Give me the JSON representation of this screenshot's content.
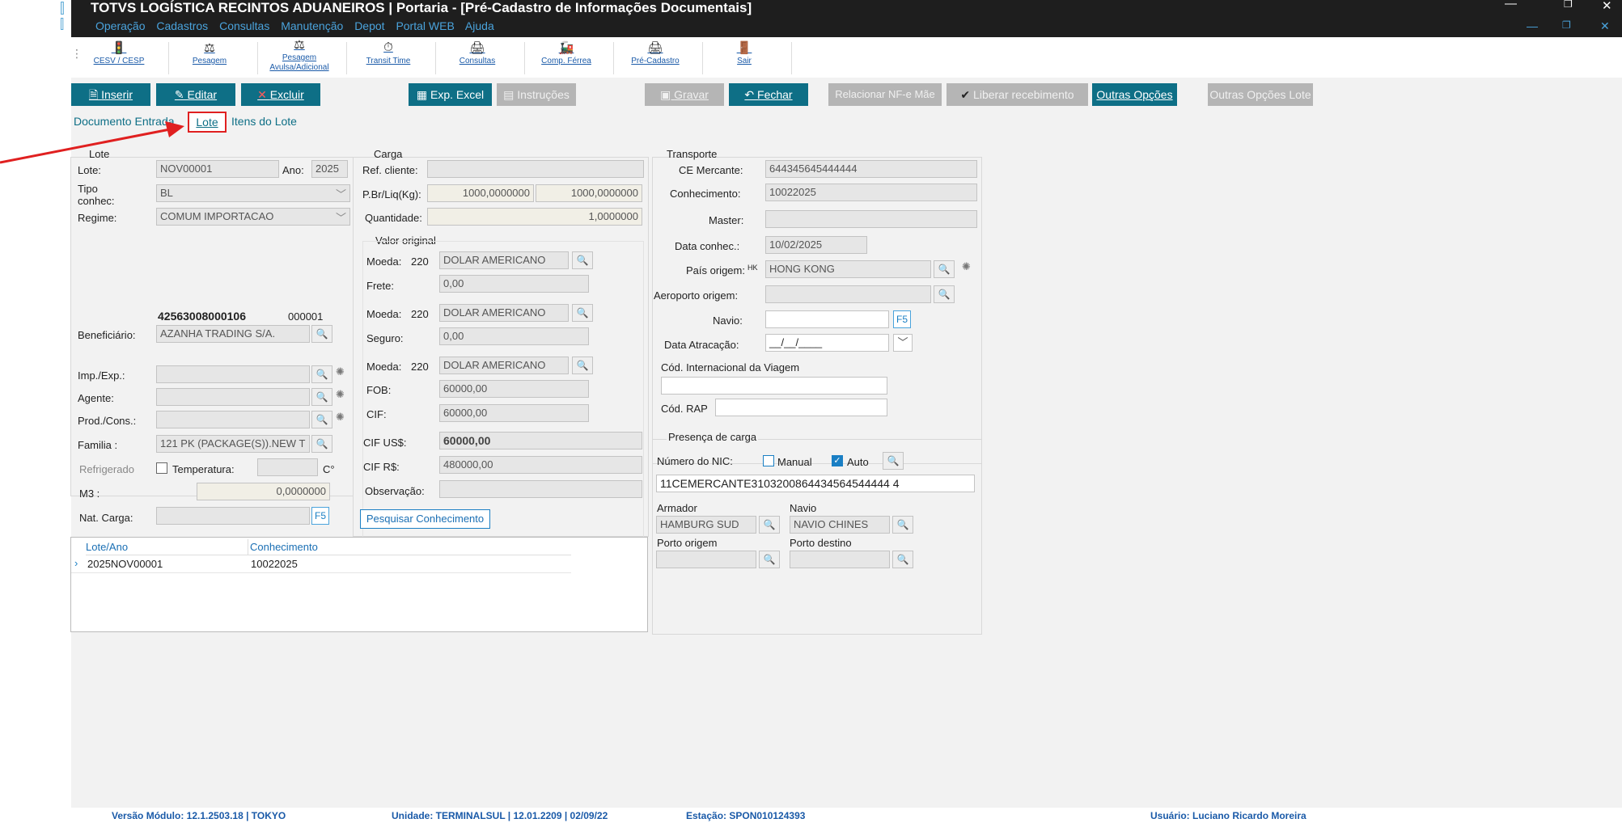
{
  "window": {
    "title": "TOTVS LOGÍSTICA RECINTOS ADUANEIROS | Portaria - [Pré-Cadastro de Informações Documentais]",
    "menu": [
      "Operação",
      "Cadastros",
      "Consultas",
      "Manutenção",
      "Depot",
      "Portal WEB",
      "Ajuda"
    ],
    "controls": {
      "minimize": "—",
      "restore": "❐",
      "close": "✕"
    }
  },
  "toolbar": [
    {
      "label": "CESV / CESP",
      "icon": "traffic-light-icon"
    },
    {
      "label": "Pesagem",
      "icon": "scale-icon"
    },
    {
      "label": "Pesagem Avulsa/Adicional",
      "icon": "scale-extra-icon"
    },
    {
      "label": "Transit Time",
      "icon": "clock-icon"
    },
    {
      "label": "Consultas",
      "icon": "printer-icon"
    },
    {
      "label": "Comp. Férrea",
      "icon": "train-icon"
    },
    {
      "label": "Pré-Cadastro",
      "icon": "form-printer-icon"
    },
    {
      "label": "Sair",
      "icon": "exit-door-icon"
    }
  ],
  "actions": {
    "inserir": "Inserir",
    "editar": "Editar",
    "excluir": "Excluir",
    "exp_excel": "Exp. Excel",
    "instrucoes": "Instruções",
    "gravar": "Gravar",
    "fechar": "Fechar",
    "relacionar": "Relacionar NF-e Mãe",
    "liberar": "Liberar recebimento",
    "outras_opcoes": "Outras Opções",
    "outras_opcoes_lote": "Outras Opções Lote"
  },
  "tabs": [
    "Documento Entrada",
    "Lote",
    "Itens do Lote"
  ],
  "lote": {
    "group": "Lote",
    "lote_label": "Lote:",
    "lote": "NOV00001",
    "ano_label": "Ano:",
    "ano": "2025",
    "tipo_label": "Tipo conhec:",
    "tipo": "BL",
    "regime_label": "Regime:",
    "regime": "COMUM IMPORTACAO",
    "cnpj": "42563008000106",
    "codigo": "000001",
    "beneficiario_label": "Beneficiário:",
    "beneficiario": "AZANHA TRADING S/A.",
    "imp_label": "Imp./Exp.:",
    "agente_label": "Agente:",
    "prod_label": "Prod./Cons.:",
    "familia_label": "Familia :",
    "familia": "121 PK (PACKAGE(S)).NEW T",
    "refrigerado_label": "Refrigerado",
    "temperatura_label": "Temperatura:",
    "temp_unit": "C°",
    "m3_label": "M3   :",
    "m3": "0,0000000",
    "nat_label": "Nat. Carga:",
    "f5": "F5"
  },
  "carga": {
    "group": "Carga",
    "ref_label": "Ref. cliente:",
    "pbr_label": "P.Br/Liq(Kg):",
    "pbr": "1000,0000000",
    "pliq": "1000,0000000",
    "qtd_label": "Quantidade:",
    "qtd": "1,0000000",
    "valor_group": "Valor original",
    "moeda_label": "Moeda:",
    "moeda_code": "220",
    "moeda": "DOLAR AMERICANO",
    "frete_label": "Frete:",
    "frete": "0,00",
    "seguro_label": "Seguro:",
    "seguro": "0,00",
    "fob_label": "FOB:",
    "fob": "60000,00",
    "cif_label": "CIF:",
    "cif": "60000,00",
    "cif_us_label": "CIF  US$:",
    "cif_us": "60000,00",
    "cif_rs_label": "CIF  R$:",
    "cif_rs": "480000,00",
    "obs_label": "Observação:",
    "pesquisar": "Pesquisar Conhecimento"
  },
  "transporte": {
    "group": "Transporte",
    "ce_label": "CE Mercante:",
    "ce": "644345645444444",
    "conhecimento_label": "Conhecimento:",
    "conhecimento": "10022025",
    "master_label": "Master:",
    "data_label": "Data conhec.:",
    "data": "10/02/2025",
    "pais_label": "País origem:",
    "pais_code": "HK",
    "pais": "HONG KONG",
    "aeroporto_label": "Aeroporto origem:",
    "navio_label": "Navio:",
    "f5": "F5",
    "atracacao_label": "Data Atracação:",
    "atracacao": "__/__/____",
    "cod_viagem_label": "Cód. Internacional da Viagem",
    "cod_rap_label": "Cód. RAP"
  },
  "presenca": {
    "group": "Presença de carga",
    "nic_label": "Número do NIC:",
    "manual_label": "Manual",
    "auto_label": "Auto",
    "check": "✓",
    "nic": "11CEMERCANTE3103200864434564544444 4",
    "armador_label": "Armador",
    "armador": "HAMBURG SUD",
    "navio_label": "Navio",
    "navio": "NAVIO CHINES",
    "porto_origem_label": "Porto origem",
    "porto_destino_label": "Porto destino"
  },
  "grid": {
    "headers": [
      "Lote/Ano",
      "Conhecimento"
    ],
    "rows": [
      {
        "lote_ano": "2025NOV00001",
        "conhecimento": "10022025"
      }
    ]
  },
  "statusbar": {
    "versao": "Versão Módulo:   12.1.2503.18  |  TOKYO",
    "unidade": "Unidade: TERMINALSUL | 12.01.2209 | 02/09/22",
    "estacao": "Estação: SPON010124393",
    "usuario": "Usuário: Luciano Ricardo Moreira"
  },
  "colors": {
    "accent": "#0e6f86",
    "annotation": "#e02020"
  }
}
